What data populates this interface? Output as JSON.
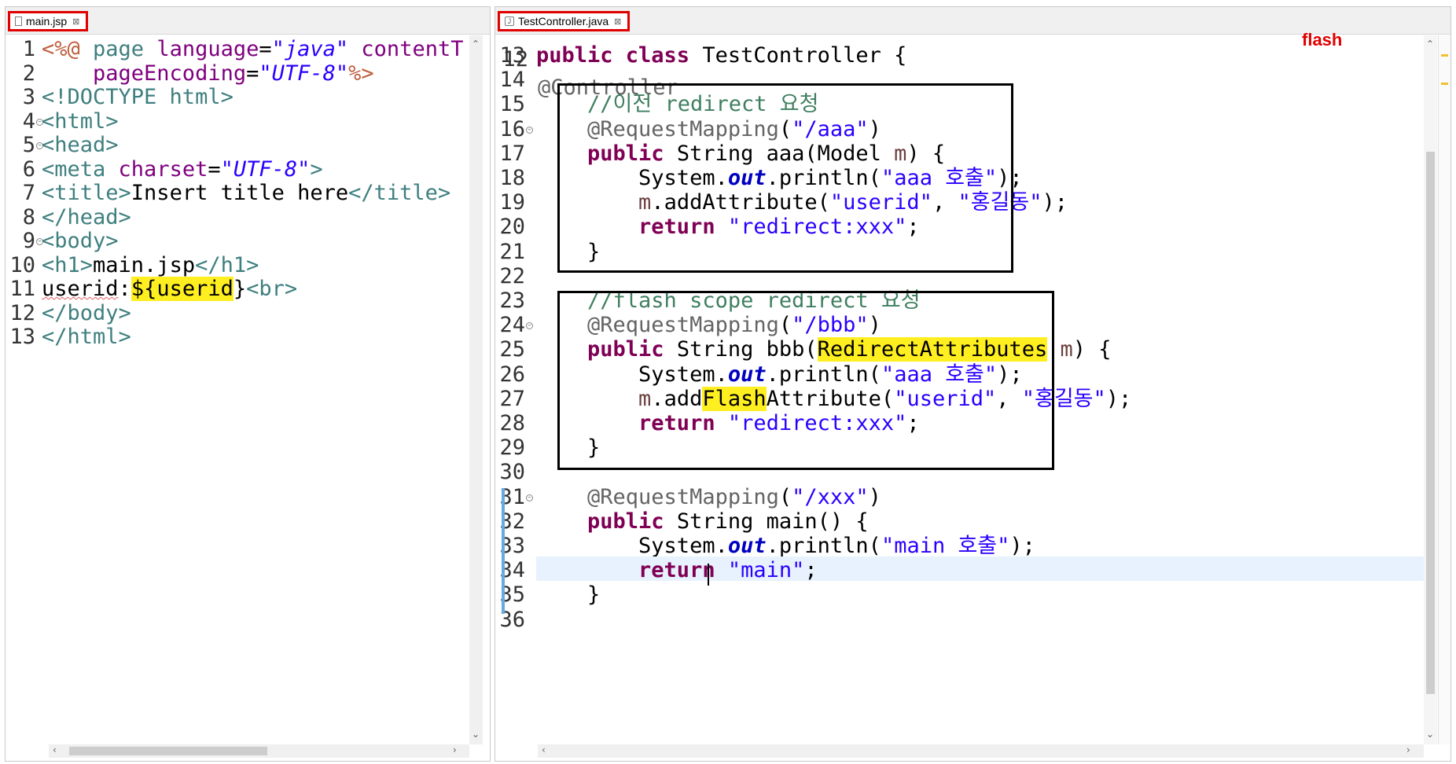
{
  "left_editor": {
    "tab": {
      "title": "main.jsp",
      "file_icon": "file-icon",
      "close_icon": "close-icon"
    },
    "lines": [
      {
        "num": "1",
        "parts": [
          {
            "t": "<%@ ",
            "c": "jdir"
          },
          {
            "t": "page ",
            "c": "jtag"
          },
          {
            "t": "language",
            "c": "jattr"
          },
          {
            "t": "=",
            "c": ""
          },
          {
            "t": "\"java\" ",
            "c": "jval"
          },
          {
            "t": "contentT",
            "c": "jattr"
          }
        ]
      },
      {
        "num": "2",
        "parts": [
          {
            "t": "    pageEncoding",
            "c": "jattr"
          },
          {
            "t": "=",
            "c": ""
          },
          {
            "t": "\"UTF-8\"",
            "c": "jval"
          },
          {
            "t": "%>",
            "c": "jdir"
          }
        ]
      },
      {
        "num": "3",
        "parts": [
          {
            "t": "<!DOCTYPE html>",
            "c": "jtag"
          }
        ]
      },
      {
        "num": "4",
        "fold": true,
        "parts": [
          {
            "t": "<html>",
            "c": "jtag"
          }
        ]
      },
      {
        "num": "5",
        "fold": true,
        "parts": [
          {
            "t": "<head>",
            "c": "jtag"
          }
        ]
      },
      {
        "num": "6",
        "parts": [
          {
            "t": "<meta ",
            "c": "jtag"
          },
          {
            "t": "charset",
            "c": "jattr"
          },
          {
            "t": "=",
            "c": ""
          },
          {
            "t": "\"UTF-8\"",
            "c": "jval"
          },
          {
            "t": ">",
            "c": "jtag"
          }
        ]
      },
      {
        "num": "7",
        "parts": [
          {
            "t": "<title>",
            "c": "jtag"
          },
          {
            "t": "Insert title here",
            "c": ""
          },
          {
            "t": "</title>",
            "c": "jtag"
          }
        ]
      },
      {
        "num": "8",
        "parts": [
          {
            "t": "</head>",
            "c": "jtag"
          }
        ]
      },
      {
        "num": "9",
        "fold": true,
        "parts": [
          {
            "t": "<body>",
            "c": "jtag"
          }
        ]
      },
      {
        "num": "10",
        "parts": [
          {
            "t": "<h1>",
            "c": "jtag"
          },
          {
            "t": "main.jsp",
            "c": ""
          },
          {
            "t": "</h1>",
            "c": "jtag"
          }
        ]
      },
      {
        "num": "11",
        "parts": [
          {
            "t": "userid",
            "c": "squig"
          },
          {
            "t": ":",
            "c": ""
          },
          {
            "t": "${",
            "c": "hl"
          },
          {
            "t": "userid",
            "c": "hl"
          },
          {
            "t": "}",
            "c": ""
          },
          {
            "t": "<br>",
            "c": "jtag"
          }
        ]
      },
      {
        "num": "12",
        "parts": [
          {
            "t": "</body>",
            "c": "jtag"
          }
        ]
      },
      {
        "num": "13",
        "parts": [
          {
            "t": "</html>",
            "c": "jtag"
          }
        ]
      }
    ]
  },
  "right_editor": {
    "tab": {
      "title": "TestController.java",
      "file_icon": "java-file-icon",
      "close_icon": "close-icon"
    },
    "partial_top": {
      "num": "12",
      "text": "@Controller"
    },
    "note": "flash",
    "lines": [
      {
        "num": "13",
        "parts": [
          {
            "t": "public class ",
            "c": "kw"
          },
          {
            "t": "TestController {",
            "c": ""
          }
        ]
      },
      {
        "num": "14",
        "parts": []
      },
      {
        "num": "15",
        "parts": [
          {
            "t": "    //이전 redirect 요청",
            "c": "cm"
          }
        ]
      },
      {
        "num": "16",
        "fold": true,
        "parts": [
          {
            "t": "    @RequestMapping",
            "c": "ann"
          },
          {
            "t": "(",
            "c": ""
          },
          {
            "t": "\"/aaa\"",
            "c": "str"
          },
          {
            "t": ")",
            "c": ""
          }
        ]
      },
      {
        "num": "17",
        "parts": [
          {
            "t": "    public ",
            "c": "kw"
          },
          {
            "t": "String aaa(Model ",
            "c": ""
          },
          {
            "t": "m",
            "c": "var"
          },
          {
            "t": ") {",
            "c": ""
          }
        ]
      },
      {
        "num": "18",
        "parts": [
          {
            "t": "        System.",
            "c": ""
          },
          {
            "t": "out",
            "c": "fld"
          },
          {
            "t": ".println(",
            "c": ""
          },
          {
            "t": "\"aaa 호출\"",
            "c": "str"
          },
          {
            "t": ");",
            "c": ""
          }
        ]
      },
      {
        "num": "19",
        "parts": [
          {
            "t": "        ",
            "c": ""
          },
          {
            "t": "m",
            "c": "var"
          },
          {
            "t": ".addAttribute(",
            "c": ""
          },
          {
            "t": "\"userid\"",
            "c": "str"
          },
          {
            "t": ", ",
            "c": ""
          },
          {
            "t": "\"홍길동\"",
            "c": "str"
          },
          {
            "t": ");",
            "c": ""
          }
        ]
      },
      {
        "num": "20",
        "parts": [
          {
            "t": "        return ",
            "c": "kw"
          },
          {
            "t": "\"redirect:xxx\"",
            "c": "str"
          },
          {
            "t": ";",
            "c": ""
          }
        ]
      },
      {
        "num": "21",
        "parts": [
          {
            "t": "    }",
            "c": ""
          }
        ]
      },
      {
        "num": "22",
        "parts": []
      },
      {
        "num": "23",
        "parts": [
          {
            "t": "    //flash scope redirect 요청",
            "c": "cm"
          }
        ]
      },
      {
        "num": "24",
        "fold": true,
        "parts": [
          {
            "t": "    @RequestMapping",
            "c": "ann"
          },
          {
            "t": "(",
            "c": ""
          },
          {
            "t": "\"/bbb\"",
            "c": "str"
          },
          {
            "t": ")",
            "c": ""
          }
        ]
      },
      {
        "num": "25",
        "parts": [
          {
            "t": "    public ",
            "c": "kw"
          },
          {
            "t": "String bbb(",
            "c": ""
          },
          {
            "t": "RedirectAttributes",
            "c": "hl"
          },
          {
            "t": " ",
            "c": ""
          },
          {
            "t": "m",
            "c": "var"
          },
          {
            "t": ") {",
            "c": ""
          }
        ]
      },
      {
        "num": "26",
        "parts": [
          {
            "t": "        System.",
            "c": ""
          },
          {
            "t": "out",
            "c": "fld"
          },
          {
            "t": ".println(",
            "c": ""
          },
          {
            "t": "\"aaa 호출\"",
            "c": "str"
          },
          {
            "t": ");",
            "c": ""
          }
        ]
      },
      {
        "num": "27",
        "parts": [
          {
            "t": "        ",
            "c": ""
          },
          {
            "t": "m",
            "c": "var"
          },
          {
            "t": ".add",
            "c": ""
          },
          {
            "t": "Flash",
            "c": "hl"
          },
          {
            "t": "Attribute(",
            "c": ""
          },
          {
            "t": "\"userid\"",
            "c": "str"
          },
          {
            "t": ", ",
            "c": ""
          },
          {
            "t": "\"홍길동\"",
            "c": "str"
          },
          {
            "t": ");",
            "c": ""
          }
        ]
      },
      {
        "num": "28",
        "parts": [
          {
            "t": "        return ",
            "c": "kw"
          },
          {
            "t": "\"redirect:xxx\"",
            "c": "str"
          },
          {
            "t": ";",
            "c": ""
          }
        ]
      },
      {
        "num": "29",
        "parts": [
          {
            "t": "    }",
            "c": ""
          }
        ]
      },
      {
        "num": "30",
        "parts": []
      },
      {
        "num": "31",
        "fold": true,
        "parts": [
          {
            "t": "    @RequestMapping",
            "c": "ann"
          },
          {
            "t": "(",
            "c": ""
          },
          {
            "t": "\"/xxx\"",
            "c": "str"
          },
          {
            "t": ")",
            "c": ""
          }
        ]
      },
      {
        "num": "32",
        "parts": [
          {
            "t": "    public ",
            "c": "kw"
          },
          {
            "t": "String main() {",
            "c": ""
          }
        ]
      },
      {
        "num": "33",
        "parts": [
          {
            "t": "        System.",
            "c": ""
          },
          {
            "t": "out",
            "c": "fld"
          },
          {
            "t": ".println(",
            "c": ""
          },
          {
            "t": "\"main 호출\"",
            "c": "str"
          },
          {
            "t": ");",
            "c": ""
          }
        ]
      },
      {
        "num": "34",
        "current": true,
        "parts": [
          {
            "t": "        return ",
            "c": "kw"
          },
          {
            "t": "\"main\"",
            "c": "str"
          },
          {
            "t": ";",
            "c": ""
          }
        ]
      },
      {
        "num": "35",
        "parts": [
          {
            "t": "    }",
            "c": ""
          }
        ]
      },
      {
        "num": "36",
        "parts": []
      }
    ]
  },
  "colors": {
    "tab_highlight": "#e00000",
    "keyword": "#7f0055",
    "string": "#2a00ff",
    "comment": "#3f7f5f",
    "annotation": "#646464",
    "static_field": "#0000c0",
    "search_highlight": "#ffef20",
    "current_line": "#e8f2fe",
    "note": "#e00000"
  }
}
